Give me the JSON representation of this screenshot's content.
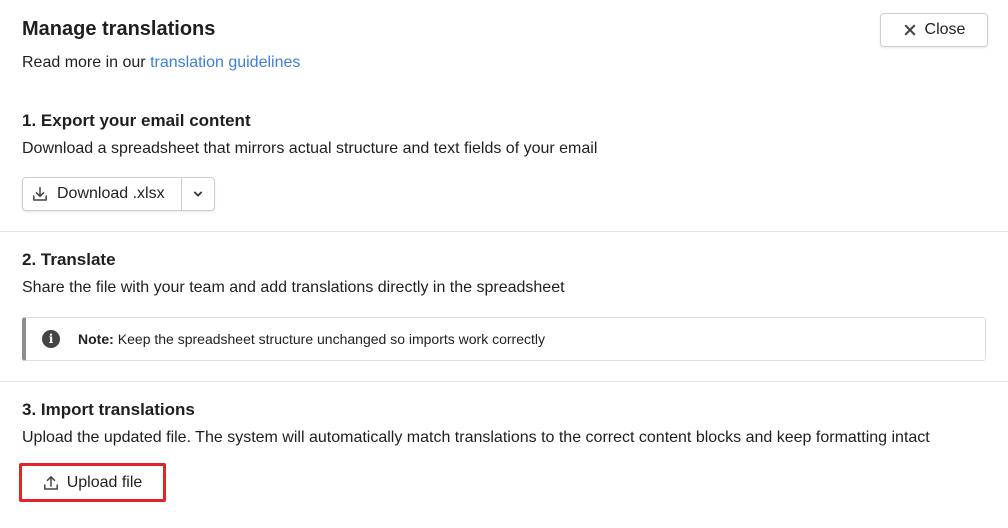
{
  "header": {
    "title": "Manage translations",
    "subtitle_prefix": "Read more in our ",
    "guidelines_link": "translation guidelines",
    "close_label": "Close"
  },
  "step1": {
    "title": "1. Export your email content",
    "description": "Download a spreadsheet that mirrors actual structure and text fields of your email",
    "download_label": "Download .xlsx",
    "download_icon": "download-icon",
    "dropdown_icon": "chevron-down-icon"
  },
  "step2": {
    "title": "2. Translate",
    "description": "Share the file with your team and add translations directly in the spreadsheet",
    "note_label": "Note:",
    "note_text": "Keep the spreadsheet structure unchanged so imports work correctly",
    "note_icon": "info-icon"
  },
  "step3": {
    "title": "3. Import translations",
    "description": "Upload the updated file. The system will automatically match translations to the correct content blocks and keep formatting intact",
    "upload_label": "Upload file",
    "upload_icon": "upload-icon"
  },
  "colors": {
    "link": "#3d7ed8",
    "highlight_border": "#e3222a",
    "note_accent": "#8d8d8d"
  }
}
